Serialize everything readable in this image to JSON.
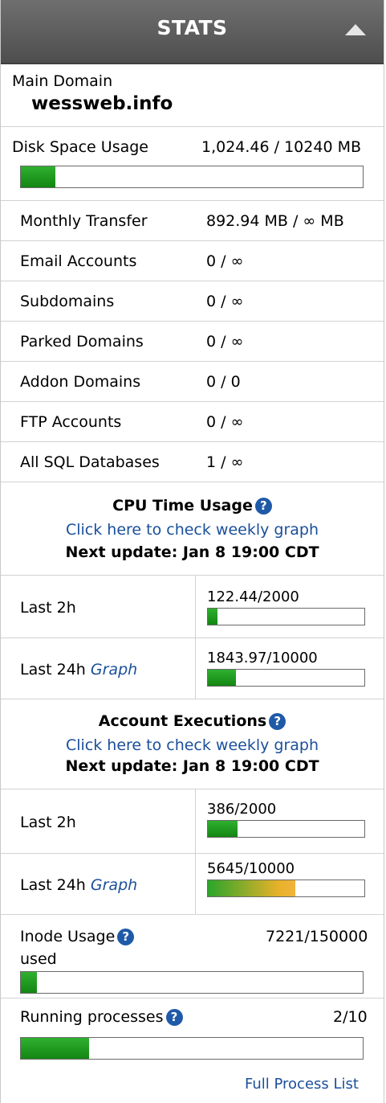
{
  "header": {
    "title": "STATS"
  },
  "main_domain": {
    "label": "Main Domain",
    "value": "wessweb.info"
  },
  "disk": {
    "label": "Disk Space Usage",
    "value": "1,024.46 / 10240 MB",
    "fraction": 0.1
  },
  "stats": [
    {
      "label": "Monthly Transfer",
      "value": "892.94 MB / ∞ MB"
    },
    {
      "label": "Email Accounts",
      "value": "0 / ∞"
    },
    {
      "label": "Subdomains",
      "value": "0 / ∞"
    },
    {
      "label": "Parked Domains",
      "value": "0 / ∞"
    },
    {
      "label": "Addon Domains",
      "value": "0 / 0"
    },
    {
      "label": "FTP Accounts",
      "value": "0 / ∞"
    },
    {
      "label": "All SQL Databases",
      "value": "1 / ∞"
    }
  ],
  "cpu": {
    "title": "CPU Time Usage",
    "link": "Click here to check weekly graph",
    "next_update": "Next update: Jan 8 19:00 CDT",
    "rows": [
      {
        "label": "Last 2h",
        "graph": "",
        "value": "122.44/2000",
        "fraction": 0.06
      },
      {
        "label": "Last 24h",
        "graph": "Graph",
        "value": "1843.97/10000",
        "fraction": 0.18
      }
    ]
  },
  "exec": {
    "title": "Account Executions",
    "link": "Click here to check weekly graph",
    "next_update": "Next update: Jan 8 19:00 CDT",
    "rows": [
      {
        "label": "Last 2h",
        "graph": "",
        "value": "386/2000",
        "fraction": 0.19
      },
      {
        "label": "Last 24h",
        "graph": "Graph",
        "value": "5645/10000",
        "fraction": 0.56
      }
    ]
  },
  "inode": {
    "label": "Inode Usage",
    "sub": "used",
    "value": "7221/150000",
    "fraction": 0.048
  },
  "processes": {
    "label": "Running processes",
    "value": "2/10",
    "fraction": 0.2,
    "link": "Full Process List"
  },
  "help_icon": "help-icon",
  "colors": {
    "header": "#595959",
    "link": "#1a4f9a",
    "bar_green": "#1f9a1f",
    "bar_warn": "#f0b43c"
  }
}
